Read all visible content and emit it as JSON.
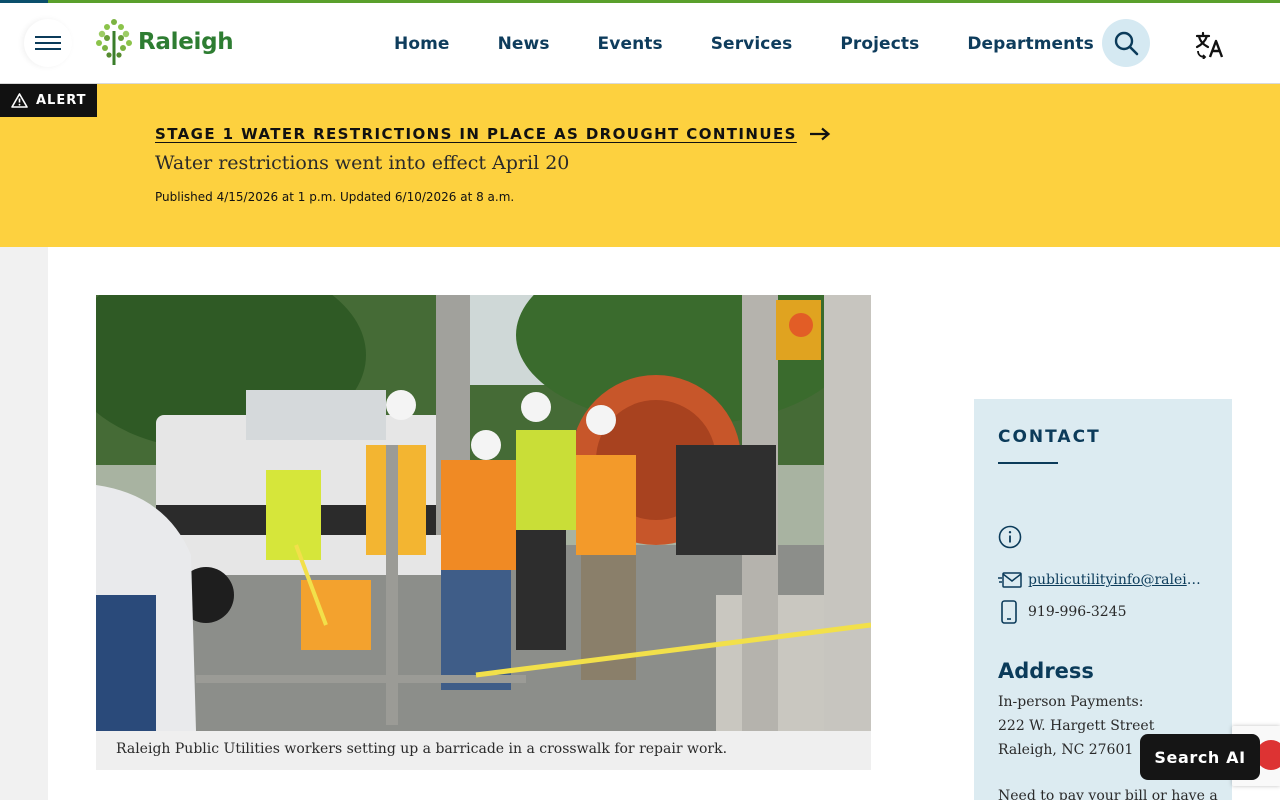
{
  "header": {
    "logo_text": "Raleigh",
    "nav": [
      "Home",
      "News",
      "Events",
      "Services",
      "Projects",
      "Departments"
    ]
  },
  "alert": {
    "tag": "ALERT",
    "title": "STAGE 1 WATER RESTRICTIONS IN PLACE AS DROUGHT CONTINUES",
    "subtitle": "Water restrictions went into effect April 20",
    "meta": "Published 4/15/2026 at 1 p.m.  Updated 6/10/2026 at 8 a.m."
  },
  "photo": {
    "caption": "Raleigh Public Utilities workers setting up a barricade in a crosswalk for repair work."
  },
  "contact": {
    "title": "CONTACT",
    "email": "publicutilityinfo@raleighnc.gov",
    "phone": "919-996-3245",
    "address_title": "Address",
    "address_lines": [
      "In-person Payments:",
      "222 W. Hargett Street",
      "Raleigh, NC 27601"
    ],
    "extra_line": "Need to pay your bill or have a"
  },
  "search_ai_label": "Search AI",
  "colors": {
    "alert_bg": "#fdd13f",
    "brand_blue": "#0b3b5a",
    "brand_green": "#2e7d32",
    "contact_bg": "#dcebf1"
  }
}
